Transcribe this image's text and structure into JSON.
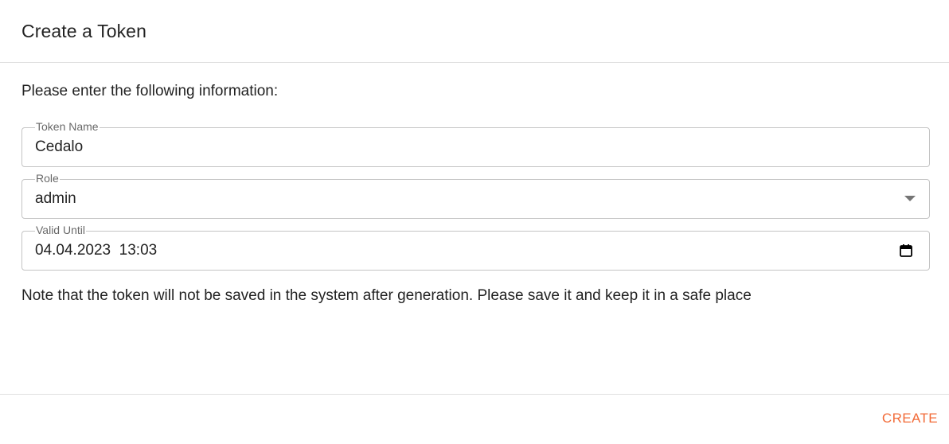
{
  "dialog": {
    "title": "Create a Token",
    "intro": "Please enter the following information:",
    "note": "Note that the token will not be saved in the system after generation. Please save it and keep it in a safe place"
  },
  "fields": {
    "token_name": {
      "label": "Token Name",
      "value": "Cedalo"
    },
    "role": {
      "label": "Role",
      "value": "admin"
    },
    "valid_until": {
      "label": "Valid Until",
      "value": "04.04.2023  13:03"
    }
  },
  "actions": {
    "create_label": "CREATE"
  },
  "icons": {
    "dropdown": "chevron-down-icon",
    "calendar": "calendar-icon"
  },
  "colors": {
    "accent": "#f26b38",
    "border": "#c4c4c4",
    "divider": "#e0e0e0"
  }
}
